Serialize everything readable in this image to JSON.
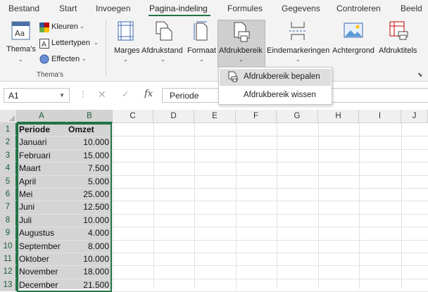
{
  "tabs": [
    "Bestand",
    "Start",
    "Invoegen",
    "Pagina-indeling",
    "Formules",
    "Gegevens",
    "Controleren",
    "Beeld"
  ],
  "active_tab": "Pagina-indeling",
  "ribbon": {
    "themes_group": {
      "label": "Thema's",
      "themes_button": "Thema's",
      "colors": "Kleuren",
      "fonts": "Lettertypen",
      "effects": "Effecten"
    },
    "page_setup": {
      "margins": "Marges",
      "orientation": "Afdrukstand",
      "size": "Formaat",
      "print_area": "Afdrukbereik",
      "breaks": "Eindemarkeringen",
      "background": "Achtergrond",
      "print_titles": "Afdruktitels"
    }
  },
  "print_area_menu": {
    "set": "Afdrukbereik bepalen",
    "clear": "Afdrukbereik wissen"
  },
  "formula_bar": {
    "name_box": "A1",
    "fx": "fx",
    "content": "Periode"
  },
  "columns": [
    "A",
    "B",
    "C",
    "D",
    "E",
    "F",
    "G",
    "H",
    "I",
    "J"
  ],
  "rows": [
    {
      "num": "1",
      "a": "Periode",
      "b": "Omzet"
    },
    {
      "num": "2",
      "a": "Januari",
      "b": "10.000"
    },
    {
      "num": "3",
      "a": "Februari",
      "b": "15.000"
    },
    {
      "num": "4",
      "a": "Maart",
      "b": "7.500"
    },
    {
      "num": "5",
      "a": "April",
      "b": "5.000"
    },
    {
      "num": "6",
      "a": "Mei",
      "b": "25.000"
    },
    {
      "num": "7",
      "a": "Juni",
      "b": "12.500"
    },
    {
      "num": "8",
      "a": "Juli",
      "b": "10.000"
    },
    {
      "num": "9",
      "a": "Augustus",
      "b": "4.000"
    },
    {
      "num": "10",
      "a": "September",
      "b": "8.000"
    },
    {
      "num": "11",
      "a": "Oktober",
      "b": "10.000"
    },
    {
      "num": "12",
      "a": "November",
      "b": "18.000"
    },
    {
      "num": "13",
      "a": "December",
      "b": "21.500"
    }
  ],
  "colors": {
    "accent": "#217346",
    "selection": "#d4d4d4"
  }
}
